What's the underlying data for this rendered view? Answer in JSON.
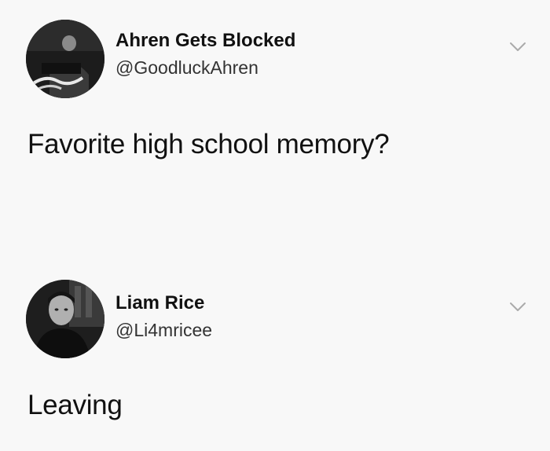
{
  "tweets": [
    {
      "display_name": "Ahren Gets Blocked",
      "handle": "@GoodluckAhren",
      "text": "Favorite high school memory?",
      "avatar_icon": "profile-photo",
      "menu_icon": "chevron-down-icon"
    },
    {
      "display_name": "Liam Rice",
      "handle": "@Li4mricee",
      "text": "Leaving",
      "avatar_icon": "profile-photo",
      "menu_icon": "chevron-down-icon"
    }
  ],
  "colors": {
    "background": "#f8f8f8",
    "text_primary": "#111111",
    "text_secondary": "#333333",
    "chevron": "#aaaaaa"
  }
}
